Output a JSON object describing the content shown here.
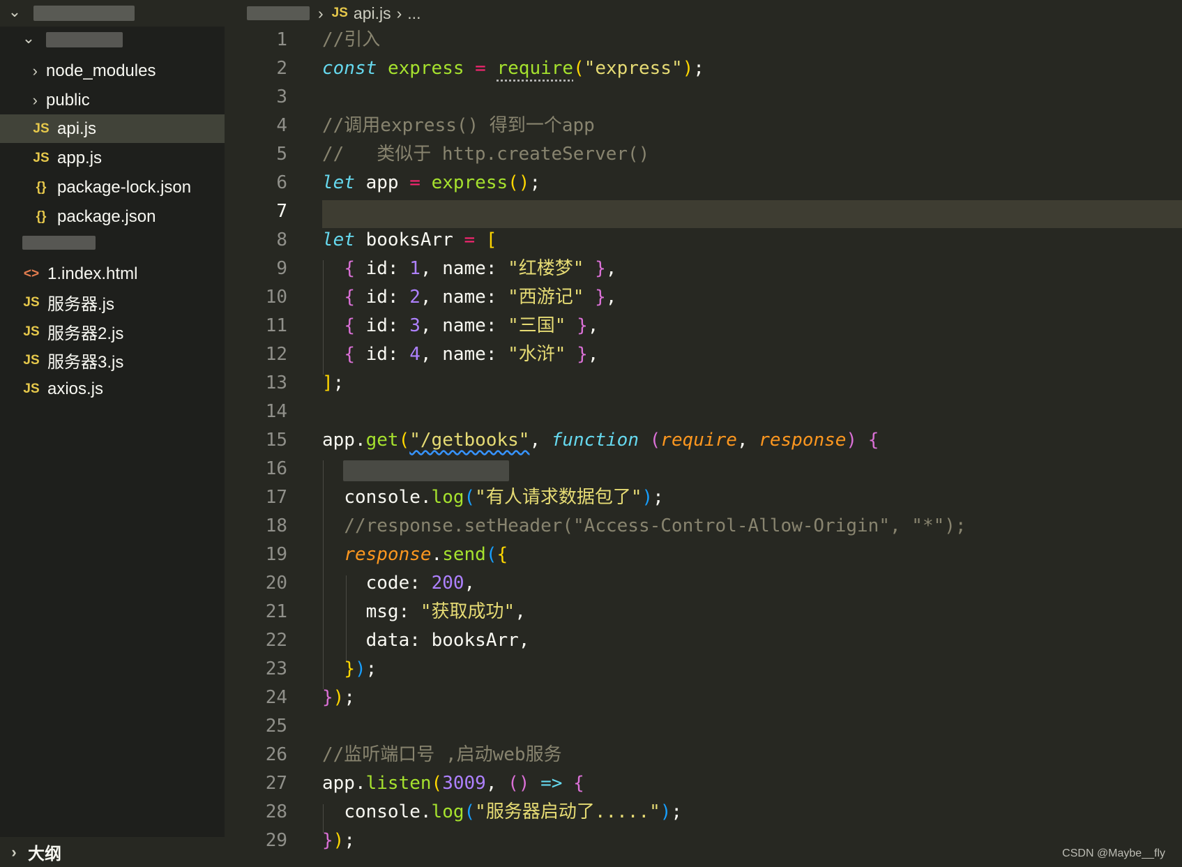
{
  "sidebar": {
    "items": [
      {
        "label": "node_modules",
        "type": "folder"
      },
      {
        "label": "public",
        "type": "folder"
      },
      {
        "label": "api.js",
        "type": "js",
        "active": true
      },
      {
        "label": "app.js",
        "type": "js"
      },
      {
        "label": "package-lock.json",
        "type": "json"
      },
      {
        "label": "package.json",
        "type": "json"
      },
      {
        "label": "1.index.html",
        "type": "html"
      },
      {
        "label": "服务器.js",
        "type": "js"
      },
      {
        "label": "服务器2.js",
        "type": "js"
      },
      {
        "label": "服务器3.js",
        "type": "js"
      },
      {
        "label": "axios.js",
        "type": "js"
      }
    ],
    "outline_label": "大纲"
  },
  "icons": {
    "js": "JS",
    "json": "{}",
    "html": "<>"
  },
  "breadcrumb": {
    "file": "api.js",
    "more": "..."
  },
  "editor": {
    "current_line": 7,
    "line_numbers": [
      "1",
      "2",
      "3",
      "4",
      "5",
      "6",
      "7",
      "8",
      "9",
      "10",
      "11",
      "12",
      "13",
      "14",
      "15",
      "16",
      "17",
      "18",
      "19",
      "20",
      "21",
      "22",
      "23",
      "24",
      "25",
      "26",
      "27",
      "28",
      "29"
    ],
    "code": {
      "l1_comment": "//引入",
      "l2_const": "const",
      "l2_var": "express",
      "l2_eq": "=",
      "l2_req": "require",
      "l2_str": "\"express\"",
      "l4_comment": "//调用express() 得到一个app",
      "l5_comment": "//   类似于 http.createServer()",
      "l6_let": "let",
      "l6_var": "app",
      "l6_eq": "=",
      "l6_fn": "express",
      "l8_let": "let",
      "l8_var": "booksArr",
      "l8_eq": "=",
      "books": [
        {
          "id": "1",
          "name": "\"红楼梦\""
        },
        {
          "id": "2",
          "name": "\"西游记\""
        },
        {
          "id": "3",
          "name": "\"三国\""
        },
        {
          "id": "4",
          "name": "\"水浒\""
        }
      ],
      "l15_obj": "app",
      "l15_method": "get",
      "l15_str": "\"/getbooks\"",
      "l15_kw": "function",
      "l15_p1": "require",
      "l15_p2": "response",
      "l17_obj": "console",
      "l17_method": "log",
      "l17_str": "\"有人请求数据包了\"",
      "l18_comment": "//response.setHeader(\"Access-Control-Allow-Origin\", \"*\");",
      "l19_obj": "response",
      "l19_method": "send",
      "l20_key": "code",
      "l20_val": "200",
      "l21_key": "msg",
      "l21_val": "\"获取成功\"",
      "l22_key": "data",
      "l22_val": "booksArr",
      "l26_comment": "//监听端口号 ,启动web服务",
      "l27_obj": "app",
      "l27_method": "listen",
      "l27_port": "3009",
      "l27_arrow": "=>",
      "l28_obj": "console",
      "l28_method": "log",
      "l28_str": "\"服务器启动了.....\""
    }
  },
  "watermark": "CSDN @Maybe__fly",
  "colors": {
    "background": "#272822",
    "sidebar": "#1e1f1c",
    "comment": "#88846f",
    "keyword": "#66d9ef",
    "function": "#a6e22e",
    "string": "#e6db74",
    "number": "#ae81ff",
    "operator": "#f92672",
    "parameter": "#fd971f"
  }
}
